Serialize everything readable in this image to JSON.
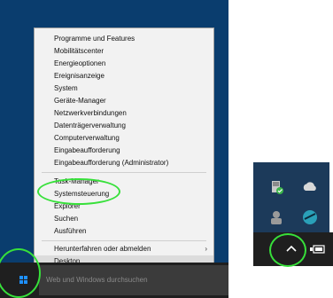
{
  "context_menu": {
    "items": [
      "Programme und Features",
      "Mobilitätscenter",
      "Energieoptionen",
      "Ereignisanzeige",
      "System",
      "Geräte-Manager",
      "Netzwerkverbindungen",
      "Datenträgerverwaltung",
      "Computerverwaltung",
      "Eingabeaufforderung",
      "Eingabeaufforderung (Administrator)",
      "Task-Manager",
      "Systemsteuerung",
      "Explorer",
      "Suchen",
      "Ausführen",
      "Herunterfahren oder abmelden",
      "Desktop"
    ],
    "submenu_arrow": "›"
  },
  "taskbar": {
    "search_placeholder": "Web und Windows durchsuchen"
  },
  "colors": {
    "highlight_circle": "#37e03a",
    "desktop": "#0a3d6e",
    "windows_logo": "#1e90ff"
  },
  "icons": {
    "start": "windows-logo-icon",
    "tray_chevron": "chevron-up-icon",
    "battery": "battery-icon"
  }
}
